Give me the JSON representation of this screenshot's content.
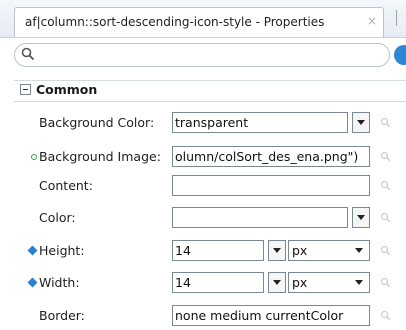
{
  "tab": {
    "title": "af|column::sort-descending-icon-style - Properties",
    "close_label": "×"
  },
  "search": {
    "placeholder": ""
  },
  "section": {
    "title": "Common"
  },
  "properties": [
    {
      "label": "Background Color:",
      "value": "transparent",
      "marker": "none",
      "unit": null
    },
    {
      "label": "Background Image:",
      "value": "olumn/colSort_des_ena.png\")",
      "marker": "green-dot",
      "unit": null
    },
    {
      "label": "Content:",
      "value": "",
      "marker": "none",
      "unit": null
    },
    {
      "label": "Color:",
      "value": "",
      "marker": "none",
      "unit": null
    },
    {
      "label": "Height:",
      "value": "14",
      "marker": "blue-diamond",
      "unit": "px"
    },
    {
      "label": "Width:",
      "value": "14",
      "marker": "blue-diamond",
      "unit": "px"
    },
    {
      "label": "Border:",
      "value": "none medium currentColor",
      "marker": "none",
      "unit": null
    }
  ],
  "colors": {
    "accent": "#2f86d8",
    "modified_marker": "#3aa844",
    "set_marker": "#2f7fd0"
  }
}
